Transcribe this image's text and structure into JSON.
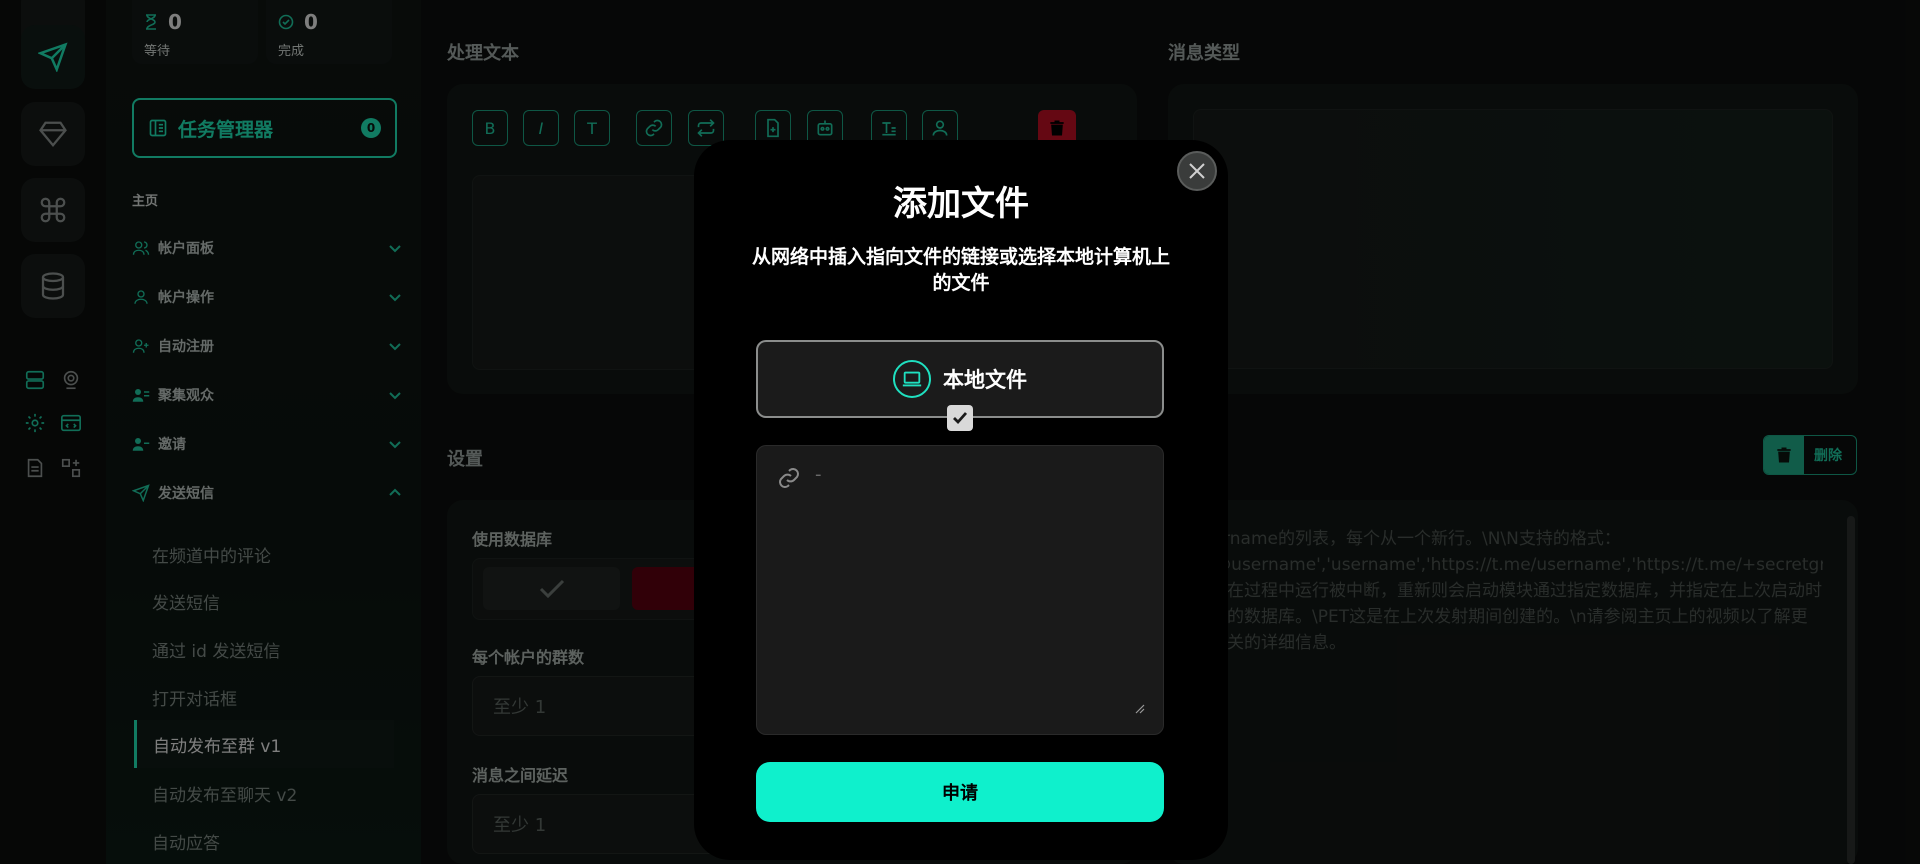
{
  "stats": [
    {
      "value": "0",
      "label": "等待"
    },
    {
      "value": "0",
      "label": "完成"
    }
  ],
  "task_manager": {
    "label": "任务管理器",
    "badge": "0"
  },
  "sidebar": {
    "section_title": "主页",
    "items": [
      {
        "label": "帐户面板"
      },
      {
        "label": "帐户操作"
      },
      {
        "label": "自动注册"
      },
      {
        "label": "聚集观众"
      },
      {
        "label": "邀请"
      },
      {
        "label": "发送短信"
      }
    ],
    "sub_items": [
      {
        "label": "在频道中的评论"
      },
      {
        "label": "发送短信"
      },
      {
        "label": "通过 id 发送短信"
      },
      {
        "label": "打开对话框"
      },
      {
        "label": "自动发布至群 v1"
      },
      {
        "label": "自动发布至聊天 v2"
      },
      {
        "label": "自动应答"
      }
    ]
  },
  "main": {
    "process_text_title": "处理文本",
    "message_type_title": "消息类型",
    "settings_title": "设置",
    "use_database_label": "使用数据库",
    "groups_per_account_label": "每个帐户的群数",
    "groups_per_account_placeholder": "至少 1",
    "delay_label": "消息之间延迟",
    "delay_placeholder": "至少 1",
    "delete_label": "删除",
    "description": "username的列表，每个从一个新行。\\N\\N支持的格式：\\n'@username','username','https://t.me/username','https://t.me/+secretgroup','https://t.me/joinchat/secretgroup'.\\n\\n如果在过程中运行被中断，重新则会启动模块通过指定数据库，并指定在上次启动时创建的数据库。\\PET这是在上次发射期间创建的。\\n请参阅主页上的视频以了解更多相关的详细信息。"
  },
  "toolbar": {
    "bold": "B",
    "italic": "I",
    "text": "T"
  },
  "modal": {
    "title": "添加文件",
    "subtitle": "从网络中插入指向文件的链接或选择本地计算机上的文件",
    "local_file_label": "本地文件",
    "url_value": "-",
    "apply_label": "申请"
  },
  "colors": {
    "accent": "#1fe0b2",
    "apply": "#0ff0cc",
    "danger": "#b80f24"
  }
}
